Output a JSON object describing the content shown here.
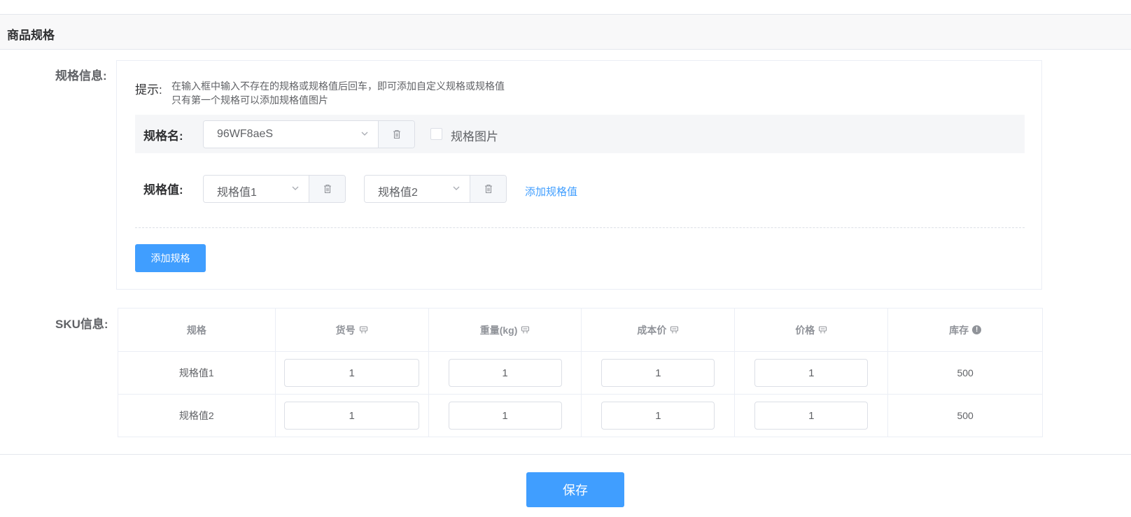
{
  "section": {
    "title": "商品规格"
  },
  "labels": {
    "spec_info": "规格信息:",
    "sku_info": "SKU信息:"
  },
  "tip": {
    "label": "提示:",
    "line1": "在输入框中输入不存在的规格或规格值后回车，即可添加自定义规格或规格值",
    "line2": "只有第一个规格可以添加规格值图片"
  },
  "spec": {
    "name_label": "规格名:",
    "name_value": "96WF8aeS",
    "image_checkbox_label": "规格图片",
    "image_checkbox_checked": false,
    "value_label": "规格值:",
    "values": [
      "规格值1",
      "规格值2"
    ],
    "add_value_link": "添加规格值",
    "add_spec_button": "添加规格"
  },
  "sku_table": {
    "headers": [
      "规格",
      "货号",
      "重量(kg)",
      "成本价",
      "价格",
      "库存"
    ],
    "rows": [
      {
        "spec": "规格值1",
        "sku_no": "1",
        "weight": "1",
        "cost": "1",
        "price": "1",
        "stock": "500"
      },
      {
        "spec": "规格值2",
        "sku_no": "1",
        "weight": "1",
        "cost": "1",
        "price": "1",
        "stock": "500"
      }
    ]
  },
  "save_button": "保存",
  "colors": {
    "primary": "#409eff",
    "border": "#dcdfe6",
    "text": "#606266"
  }
}
